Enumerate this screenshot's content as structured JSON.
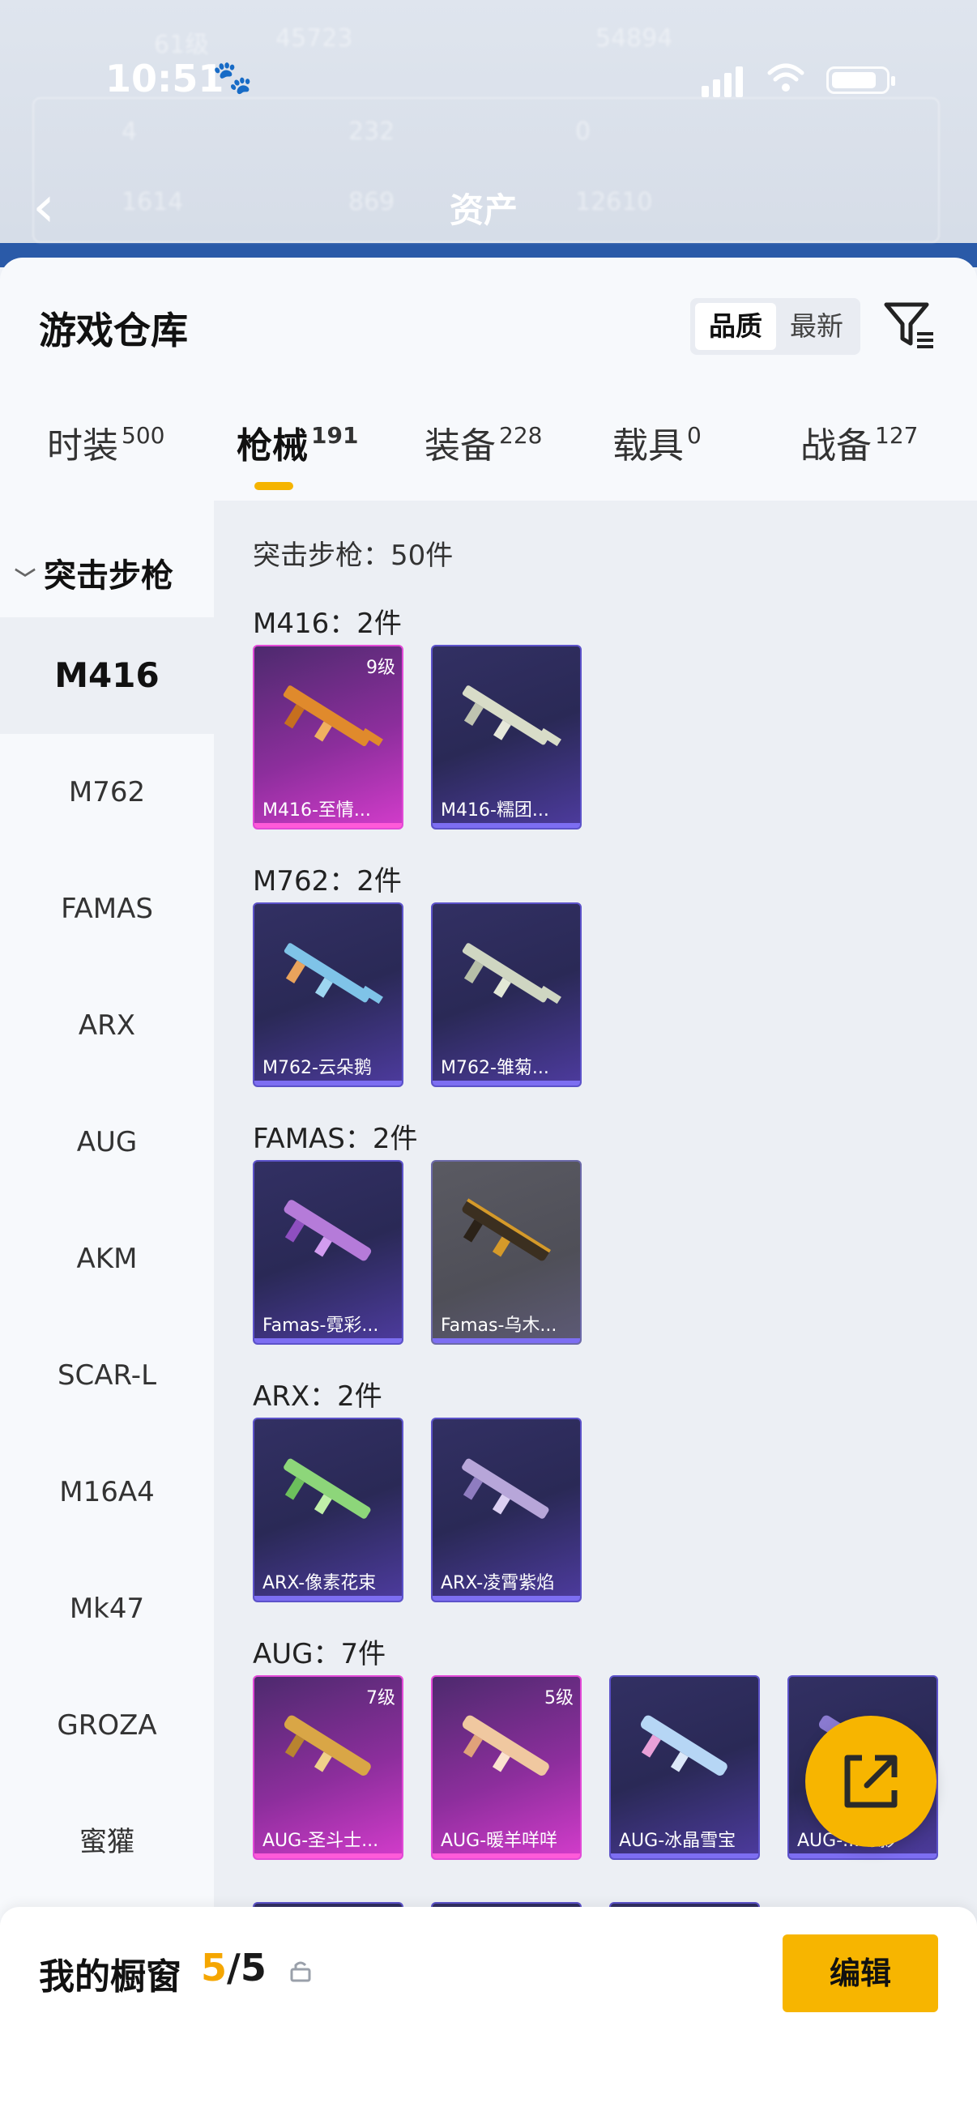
{
  "background": {
    "title": "资产",
    "ghost_texts": [
      "61级",
      "45723",
      "54894",
      "4",
      "232",
      "0",
      "1614",
      "869",
      "12610"
    ]
  },
  "status_bar": {
    "time": "10:51"
  },
  "sheet": {
    "title": "游戏仓库",
    "sort_options": [
      "品质",
      "最新"
    ]
  },
  "tabs": [
    {
      "label": "时装",
      "count": "500"
    },
    {
      "label": "枪械",
      "count": "191"
    },
    {
      "label": "装备",
      "count": "228"
    },
    {
      "label": "载具",
      "count": "0"
    },
    {
      "label": "战备",
      "count": "127"
    }
  ],
  "rail": {
    "header": "突击步枪",
    "items": [
      "M416",
      "M762",
      "FAMAS",
      "ARX",
      "AUG",
      "AKM",
      "SCAR-L",
      "M16A4",
      "Mk47",
      "GROZA",
      "蜜獾"
    ]
  },
  "content": {
    "subtitle": "突击步枪：50件",
    "groups": [
      {
        "title": "M416：2件",
        "items": [
          {
            "name": "M416-至情...",
            "level": "9级",
            "rarity": "pink"
          },
          {
            "name": "M416-糯团...",
            "level": "",
            "rarity": "purple"
          }
        ]
      },
      {
        "title": "M762：2件",
        "items": [
          {
            "name": "M762-云朵鹅",
            "level": "",
            "rarity": "purple"
          },
          {
            "name": "M762-雏菊...",
            "level": "",
            "rarity": "purple"
          }
        ]
      },
      {
        "title": "FAMAS：2件",
        "items": [
          {
            "name": "Famas-霓彩...",
            "level": "",
            "rarity": "purple"
          },
          {
            "name": "Famas-乌木...",
            "level": "",
            "rarity": "grey"
          }
        ]
      },
      {
        "title": "ARX：2件",
        "items": [
          {
            "name": "ARX-像素花束",
            "level": "",
            "rarity": "purple"
          },
          {
            "name": "ARX-凌霄紫焰",
            "level": "",
            "rarity": "purple"
          }
        ]
      },
      {
        "title": "AUG：7件",
        "items": [
          {
            "name": "AUG-圣斗士...",
            "level": "7级",
            "rarity": "pink"
          },
          {
            "name": "AUG-暖羊咩咩",
            "level": "5级",
            "rarity": "pink"
          },
          {
            "name": "AUG-冰晶雪宝",
            "level": "",
            "rarity": "purple"
          },
          {
            "name": "AUG-...幻影",
            "level": "",
            "rarity": "purple"
          }
        ]
      }
    ]
  },
  "bottom_bar": {
    "label": "我的橱窗",
    "current": "5",
    "total": "/5",
    "edit_label": "编辑"
  },
  "colors": {
    "accent": "#f7b500",
    "epic_pink": "#d33ccb",
    "purple": "#5c52c9"
  }
}
